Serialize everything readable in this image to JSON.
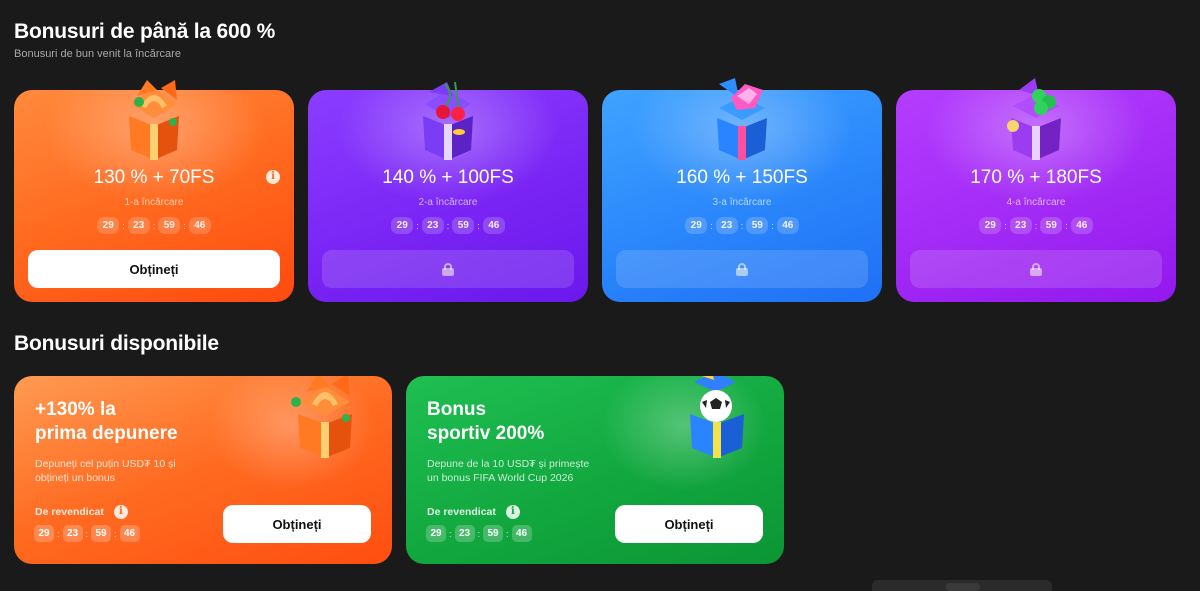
{
  "welcome": {
    "title": "Bonusuri de până la 600 %",
    "subtitle": "Bonusuri de bun venit la încărcare",
    "cards": [
      {
        "amount": "130 % + 70FS",
        "deposit": "1-a încărcare",
        "timer": [
          "29",
          "23",
          "59",
          "46"
        ],
        "button": "Obțineți",
        "locked": false,
        "info": "i"
      },
      {
        "amount": "140 % + 100FS",
        "deposit": "2-a încărcare",
        "timer": [
          "29",
          "23",
          "59",
          "46"
        ],
        "locked": true
      },
      {
        "amount": "160 % + 150FS",
        "deposit": "3-a încărcare",
        "timer": [
          "29",
          "23",
          "59",
          "46"
        ],
        "locked": true
      },
      {
        "amount": "170 % + 180FS",
        "deposit": "4-a încărcare",
        "timer": [
          "29",
          "23",
          "59",
          "46"
        ],
        "locked": true
      }
    ]
  },
  "available": {
    "title": "Bonusuri disponibile",
    "cards": [
      {
        "title_line1": "+130% la",
        "title_line2": "prima depunere",
        "desc_line1": "Depuneți cel puțin USD₮ 10 și",
        "desc_line2": "obțineți un bonus",
        "claim": "De revendicat",
        "timer": [
          "29",
          "23",
          "59",
          "46"
        ],
        "button": "Obțineți"
      },
      {
        "title_line1": "Bonus",
        "title_line2": "sportiv 200%",
        "desc_line1": "Depune de la 10 USD₮ și primește",
        "desc_line2": "un bonus FIFA World Cup 2026",
        "claim": "De revendicat",
        "timer": [
          "29",
          "23",
          "59",
          "46"
        ],
        "button": "Obțineți"
      }
    ]
  },
  "colors": {
    "background": "#1a1a1a",
    "orange": "#ff6a1f",
    "purple": "#7a25f5",
    "blue": "#2a86fb",
    "violet": "#a22af5",
    "green": "#12a83f"
  },
  "icons": [
    "gift-box-horseshoe-icon",
    "gift-box-cherry-icon",
    "gift-box-diamond-icon",
    "gift-box-clover-icon",
    "gift-box-football-icon",
    "info-icon",
    "lock-icon"
  ]
}
